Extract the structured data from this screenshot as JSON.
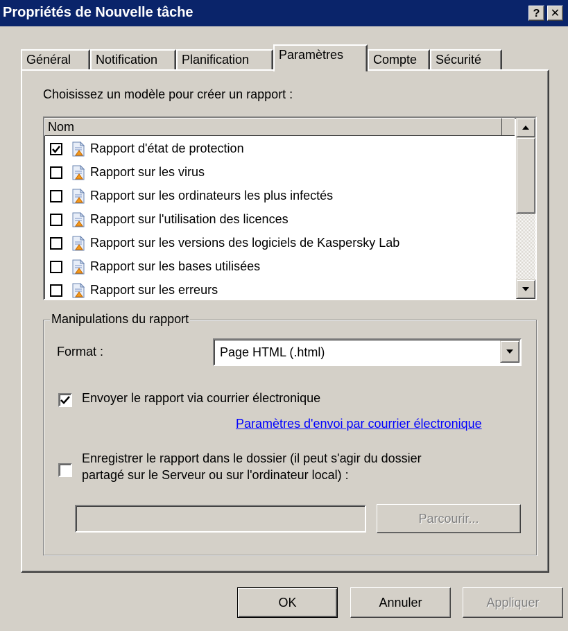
{
  "window": {
    "title": "Propriétés de Nouvelle tâche",
    "help_button": "?",
    "close_button": "✕"
  },
  "tabs": [
    {
      "label": "Général",
      "active": false
    },
    {
      "label": "Notification",
      "active": false
    },
    {
      "label": "Planification",
      "active": false
    },
    {
      "label": "Paramètres",
      "active": true
    },
    {
      "label": "Compte",
      "active": false
    },
    {
      "label": "Sécurité",
      "active": false
    }
  ],
  "templates": {
    "prompt": "Choisissez un modèle pour créer un rapport :",
    "column_header": "Nom",
    "items": [
      {
        "label": "Rapport d'état de protection",
        "checked": true
      },
      {
        "label": "Rapport sur les virus",
        "checked": false
      },
      {
        "label": "Rapport sur les ordinateurs les plus infectés",
        "checked": false
      },
      {
        "label": "Rapport sur l'utilisation des licences",
        "checked": false
      },
      {
        "label": "Rapport sur les versions des logiciels de Kaspersky Lab",
        "checked": false
      },
      {
        "label": "Rapport sur les bases utilisées",
        "checked": false
      },
      {
        "label": "Rapport sur les erreurs",
        "checked": false
      }
    ],
    "item_icon": "report-doc-icon"
  },
  "manipulations": {
    "group_title": "Manipulations du rapport",
    "format_label": "Format :",
    "format_value": "Page HTML (.html)",
    "send_email": {
      "label": "Envoyer le rapport via courrier électronique",
      "checked": true
    },
    "email_settings_link": "Paramètres d'envoi par courrier électronique",
    "save_folder": {
      "label_line1": "Enregistrer le rapport dans le dossier (il peut s'agir du dossier",
      "label_line2": "partagé sur le Serveur ou sur l'ordinateur local) :",
      "checked": false
    },
    "folder_path": "",
    "browse_label": "Parcourir..."
  },
  "buttons": {
    "ok": "OK",
    "cancel": "Annuler",
    "apply": "Appliquer"
  },
  "colors": {
    "titlebar": "#0a246a",
    "face": "#d4d0c8",
    "link": "#0000ff"
  }
}
